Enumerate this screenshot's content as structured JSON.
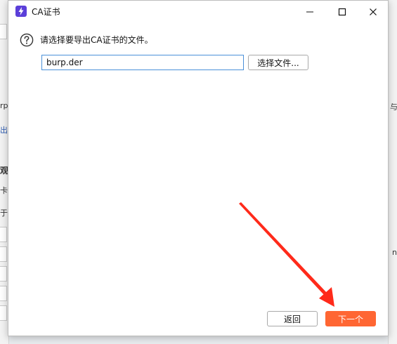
{
  "window": {
    "title": "CA证书"
  },
  "prompt": {
    "text": "请选择要导出CA证书的文件。"
  },
  "file_input": {
    "value": "burp.der"
  },
  "buttons": {
    "choose_file": "选择文件...",
    "back": "返回",
    "next": "下一个"
  },
  "background_fragments": {
    "left_1": "rp",
    "left_2": "出C",
    "left_3": "观",
    "left_4": "卡",
    "left_5": "于i",
    "right_1": "与",
    "right_2": "n"
  },
  "colors": {
    "accent": "#ff6633",
    "input_border": "#4a90d9",
    "annotation_arrow": "#ff2a1a",
    "app_icon": "#5b3fd9"
  },
  "icons": {
    "app": "lightning-icon",
    "question": "question-icon",
    "minimize": "minimize-icon",
    "maximize": "maximize-icon",
    "close": "close-icon"
  }
}
